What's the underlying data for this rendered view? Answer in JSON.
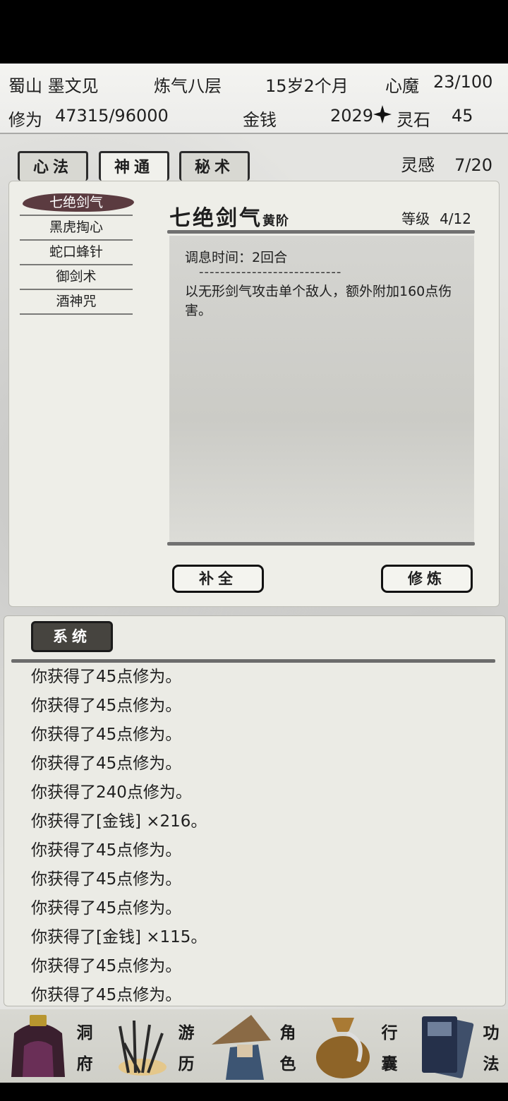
{
  "header": {
    "name": "蜀山 墨文见",
    "realm": "炼气八层",
    "age": "15岁2个月",
    "demon_label": "心魔",
    "demon_value": "23/100",
    "cultivation_label": "修为",
    "cultivation_value": "47315/96000",
    "money_label": "金钱",
    "money_value": "2029",
    "spirit_label": "灵石",
    "spirit_value": "45"
  },
  "tabs": [
    {
      "label": "心法",
      "active": false
    },
    {
      "label": "神通",
      "active": true
    },
    {
      "label": "秘术",
      "active": false
    }
  ],
  "inspiration": {
    "label": "灵感",
    "value": "7/20"
  },
  "skills": [
    "七绝剑气",
    "黑虎掏心",
    "蛇口蜂针",
    "御剑术",
    "酒神咒"
  ],
  "detail": {
    "title": "七绝剑气",
    "grade": "黄阶",
    "level_label": "等级",
    "level_value": "4/12",
    "time": "调息时间：2回合",
    "divider": "---------------------------",
    "text": "以无形剑气攻击单个敌人，额外附加160点伤害。"
  },
  "buttons": {
    "complete": "补全",
    "train": "修炼"
  },
  "log": {
    "tab": "系统",
    "lines": [
      "你获得了45点修为。",
      "你获得了45点修为。",
      "你获得了45点修为。",
      "你获得了45点修为。",
      "你获得了240点修为。",
      "你获得了[金钱] ×216。",
      "你获得了45点修为。",
      "你获得了45点修为。",
      "你获得了45点修为。",
      "你获得了[金钱] ×115。",
      "你获得了45点修为。",
      "你获得了45点修为。"
    ]
  },
  "nav": [
    {
      "label": "洞府",
      "chars": [
        "洞",
        "府"
      ],
      "icon": "cave-dwelling-icon"
    },
    {
      "label": "游历",
      "chars": [
        "游",
        "历"
      ],
      "icon": "travel-grass-icon"
    },
    {
      "label": "角色",
      "chars": [
        "角",
        "色"
      ],
      "icon": "character-straw-hat-icon"
    },
    {
      "label": "行囊",
      "chars": [
        "行",
        "囊"
      ],
      "icon": "inventory-bag-icon"
    },
    {
      "label": "功法",
      "chars": [
        "功",
        "法"
      ],
      "icon": "technique-books-icon"
    }
  ]
}
